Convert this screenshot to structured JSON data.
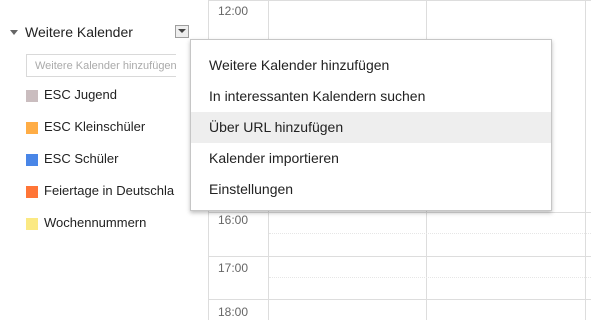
{
  "sidebar": {
    "section_title": "Weitere Kalender",
    "add_input": {
      "placeholder": "Weitere Kalender hinzufügen",
      "value": ""
    },
    "calendars": [
      {
        "name": "ESC Jugend",
        "color": "#cabdbf"
      },
      {
        "name": "ESC Kleinschüler",
        "color": "#ffad46"
      },
      {
        "name": "ESC Schüler",
        "color": "#4986e7"
      },
      {
        "name": "Feiertage in Deutschland",
        "color": "#ff7537"
      },
      {
        "name": "Wochennummern",
        "color": "#fbe983"
      }
    ]
  },
  "grid": {
    "times": [
      "12:00",
      "16:00",
      "17:00",
      "18:00"
    ]
  },
  "menu": {
    "items": [
      {
        "label": "Weitere Kalender hinzufügen"
      },
      {
        "label": "In interessanten Kalendern suchen"
      },
      {
        "label": "Über URL hinzufügen",
        "hovered": true
      },
      {
        "label": "Kalender importieren"
      },
      {
        "label": "Einstellungen"
      }
    ]
  }
}
